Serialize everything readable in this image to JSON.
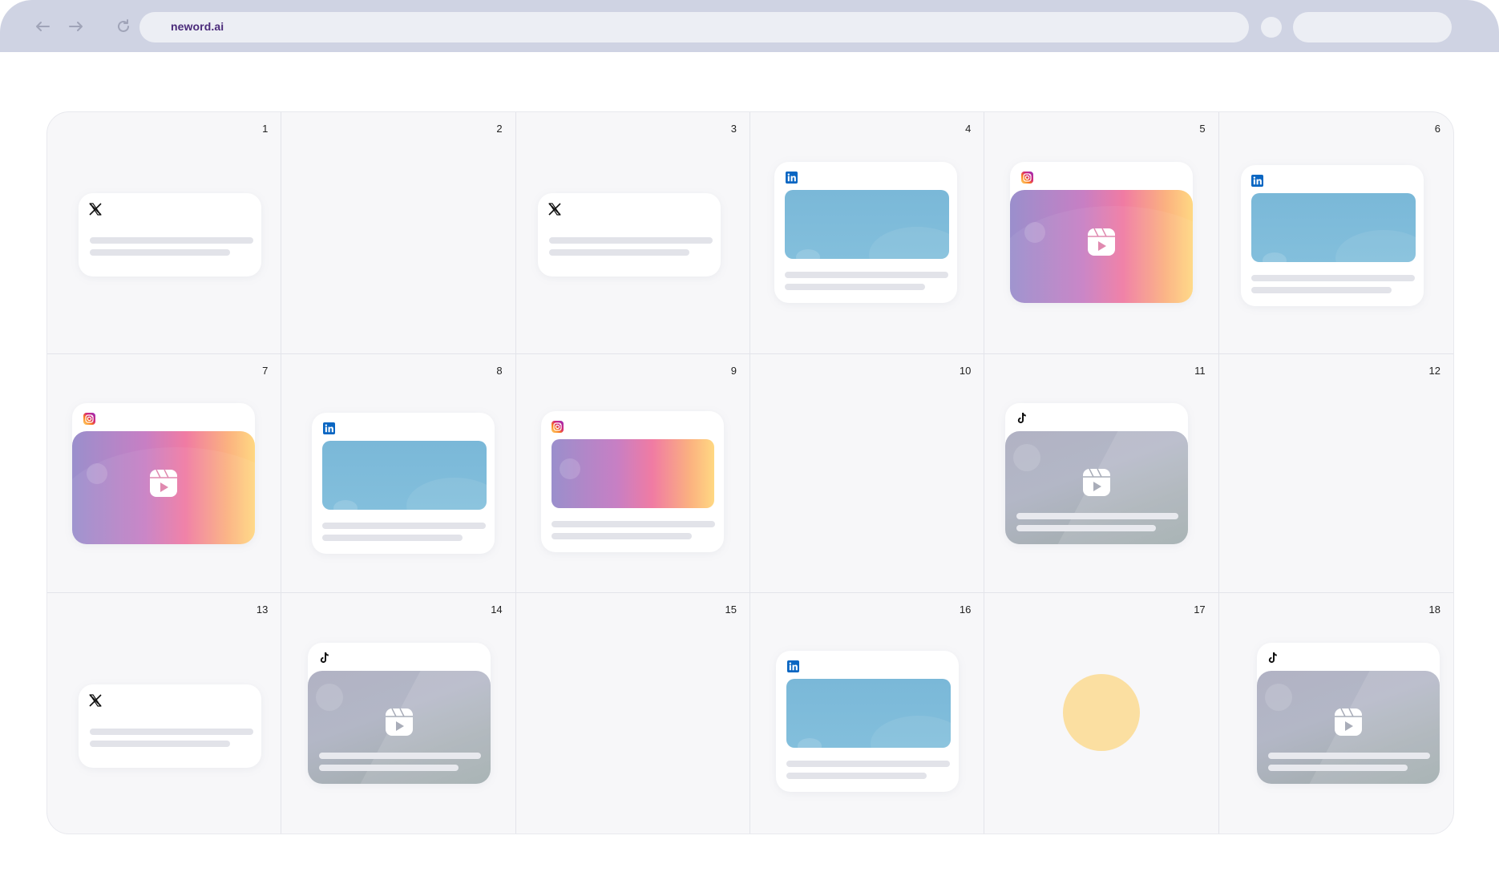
{
  "browser": {
    "url": "neword.ai",
    "icons": [
      "back-arrow-icon",
      "forward-arrow-icon",
      "reload-icon"
    ]
  },
  "calendar": {
    "days": [
      "1",
      "2",
      "3",
      "4",
      "5",
      "6",
      "7",
      "8",
      "9",
      "10",
      "11",
      "12",
      "13",
      "14",
      "15",
      "16",
      "17",
      "18"
    ]
  },
  "colors": {
    "chrome": "#cfd3e3",
    "url_text": "#4a2a7a",
    "linkedin": "#0a66c2",
    "tiktok": "#111111",
    "placeholder_sun": "#fbdfa1"
  }
}
